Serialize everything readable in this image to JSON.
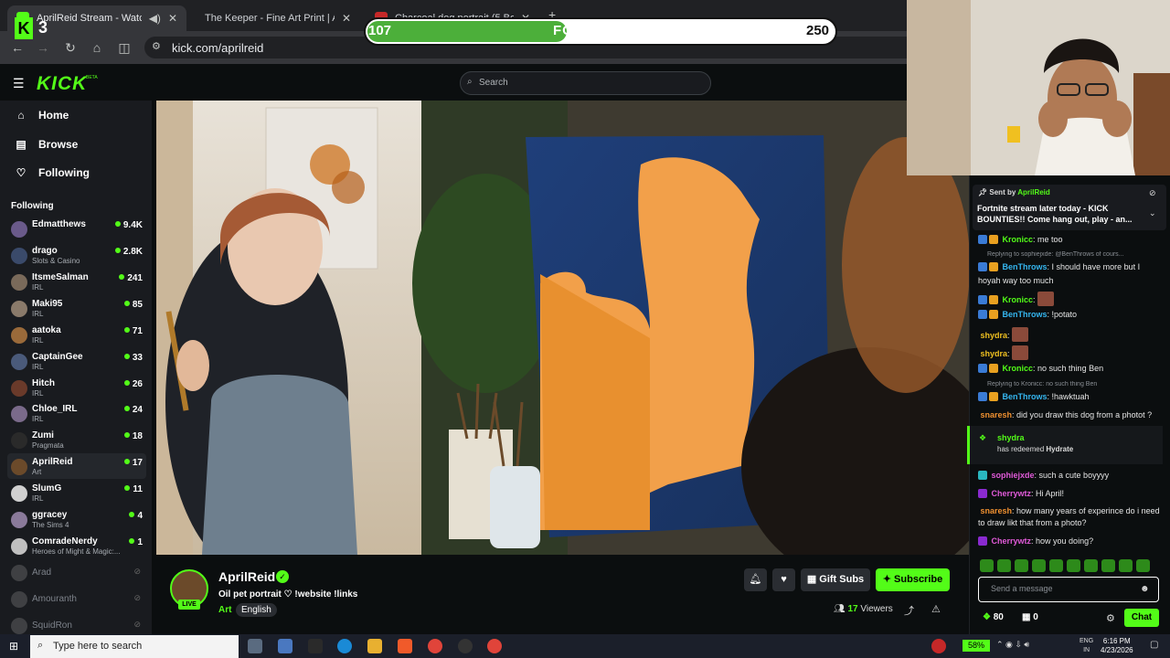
{
  "browser": {
    "tabs": [
      {
        "title": "AprilReid Stream - Watch Live on"
      },
      {
        "title": "The Keeper - Fine Art Print | April Reid"
      },
      {
        "title": "Charcoal dog portrait (5 Boxer Dogs)"
      }
    ],
    "new_tab": "+",
    "url": "kick.com/aprilreid"
  },
  "overlay": {
    "followers_label": "FOLLOWERS",
    "followers_current": "107",
    "followers_goal": "250",
    "followers_progress": 0.428,
    "kick_count": "3"
  },
  "kick": {
    "logo": "KICK",
    "beta": "BETA",
    "search_placeholder": "Search"
  },
  "sidebar": {
    "nav": [
      {
        "label": "Home",
        "icon": "home-icon"
      },
      {
        "label": "Browse",
        "icon": "browse-icon"
      },
      {
        "label": "Following",
        "icon": "heart-icon"
      }
    ],
    "following_heading": "Following",
    "channels": [
      {
        "name": "Edmatthews",
        "category": "",
        "viewers": "9.4K",
        "color": "#6a5a8a"
      },
      {
        "name": "drago",
        "category": "Slots & Casino",
        "viewers": "2.8K",
        "color": "#3a4a6a"
      },
      {
        "name": "ItsmeSalman",
        "category": "IRL",
        "viewers": "241",
        "color": "#7a6a5a"
      },
      {
        "name": "Maki95",
        "category": "IRL",
        "viewers": "85",
        "color": "#8a7a6a"
      },
      {
        "name": "aatoka",
        "category": "IRL",
        "viewers": "71",
        "color": "#9a6a3a"
      },
      {
        "name": "CaptainGee",
        "category": "IRL",
        "viewers": "33",
        "color": "#4a5a7a"
      },
      {
        "name": "Hitch",
        "category": "IRL",
        "viewers": "26",
        "color": "#6a3a2a"
      },
      {
        "name": "Chloe_IRL",
        "category": "IRL",
        "viewers": "24",
        "color": "#7a6a8a"
      },
      {
        "name": "Zumi",
        "category": "Pragmata",
        "viewers": "18",
        "color": "#2a2a2a"
      },
      {
        "name": "AprilReid",
        "category": "Art",
        "viewers": "17",
        "color": "#6b4a2a"
      },
      {
        "name": "SlumG",
        "category": "IRL",
        "viewers": "11",
        "color": "#d0d0d0"
      },
      {
        "name": "ggracey",
        "category": "The Sims 4",
        "viewers": "4",
        "color": "#8a7a9a"
      },
      {
        "name": "ComradeNerdy",
        "category": "Heroes of Might & Magic:...",
        "viewers": "1",
        "color": "#c0c0c0"
      }
    ],
    "offline": [
      {
        "name": "Arad"
      },
      {
        "name": "Amouranth"
      },
      {
        "name": "SquidRon"
      }
    ]
  },
  "stream": {
    "name": "AprilReid",
    "title": "Oil pet portrait ♡ !website !links",
    "category": "Art",
    "language": "English",
    "live_badge": "LIVE",
    "viewers_count": "17",
    "viewers_label": "Viewers",
    "gift_label": "Gift Subs",
    "subscribe_label": "Subscribe"
  },
  "chat": {
    "pinned_by_label": "Sent by",
    "pinned_by_user": "AprilReid",
    "pinned_message": "Fortnite stream later today - KICK BOUNTIES!! Come hang out, play - an...",
    "messages": [
      {
        "user": "Kronicc",
        "text": ": me too",
        "color": "#53fc18"
      },
      {
        "reply": "Replying to sophiejxde: @BenThrows of cours..."
      },
      {
        "user": "BenThrows",
        "text": ": I should have more but I hoyah way too much",
        "color": "#35b6f0"
      },
      {
        "user": "Kronicc",
        "text": ":",
        "color": "#53fc18",
        "emote": true
      },
      {
        "user": "BenThrows",
        "text": ": !potato",
        "color": "#35b6f0"
      },
      {
        "user": "shydra",
        "text": ":",
        "color": "#f0c020",
        "emote": true
      },
      {
        "user": "shydra",
        "text": ":",
        "color": "#f0c020",
        "emote": true
      },
      {
        "user": "Kronicc",
        "text": ": no such thing Ben",
        "color": "#53fc18"
      },
      {
        "reply": "Replying to Kronicc: no such thing Ben"
      },
      {
        "user": "BenThrows",
        "text": ": !hawktuah",
        "color": "#35b6f0"
      },
      {
        "user": "snaresh",
        "text": ": did you draw this dog from a photot ?",
        "color": "#f09030"
      },
      {
        "user": "sophiejxde",
        "text": ": such a cute boyyyy",
        "color": "#e05ad8"
      },
      {
        "user": "Cherrywtz",
        "text": ": Hi April!",
        "color": "#e05ad8"
      },
      {
        "user": "snaresh",
        "text": ": how many years of experince do i need to draw likt that from a photo?",
        "color": "#f09030"
      },
      {
        "user": "Cherrywtz",
        "text": ": how you doing?",
        "color": "#e05ad8"
      }
    ],
    "redeem_user": "shydra",
    "redeem_text": "has redeemed",
    "redeem_reward": "Hydrate",
    "input_placeholder": "Send a message",
    "points": "80",
    "gifts": "0",
    "chat_button": "Chat"
  },
  "taskbar": {
    "search_placeholder": "Type here to search",
    "battery": "58%",
    "lang_line1": "ENG",
    "lang_line2": "IN",
    "time": "6:16 PM",
    "date": "4/23/2026"
  }
}
